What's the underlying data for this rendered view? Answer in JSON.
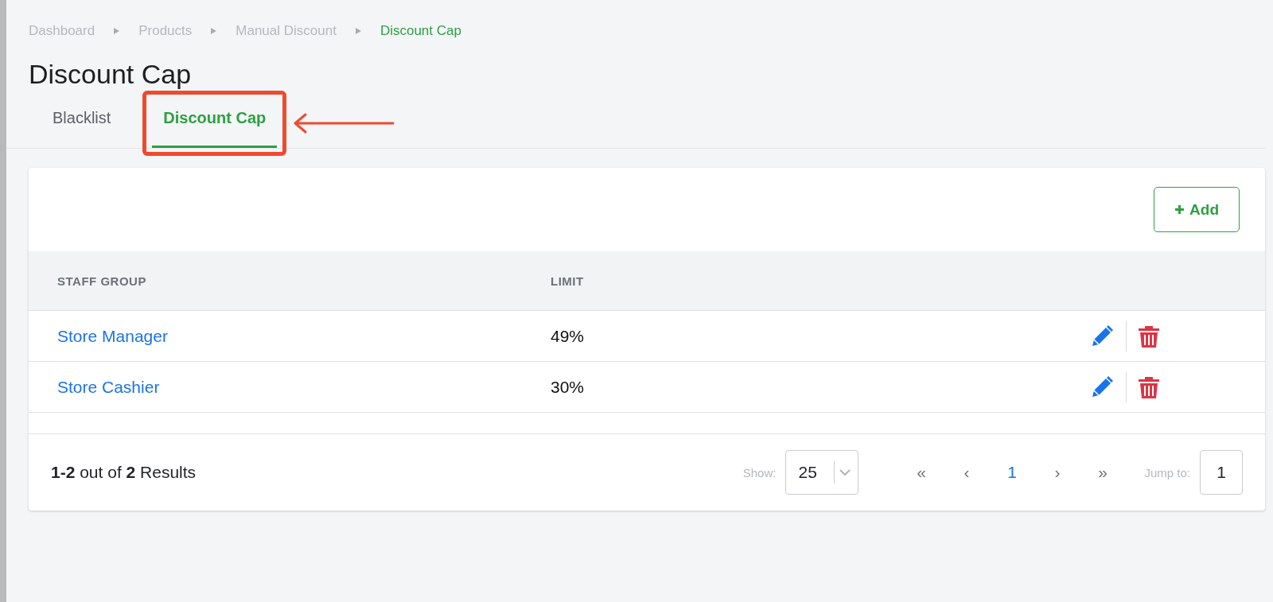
{
  "breadcrumb": [
    {
      "label": "Dashboard",
      "current": false
    },
    {
      "label": "Products",
      "current": false
    },
    {
      "label": "Manual Discount",
      "current": false
    },
    {
      "label": "Discount Cap",
      "current": true
    }
  ],
  "title": "Discount Cap",
  "tabs": [
    {
      "label": "Blacklist",
      "selected": false,
      "highlighted": false
    },
    {
      "label": "Discount Cap",
      "selected": true,
      "highlighted": true
    }
  ],
  "add_button": {
    "label": "Add"
  },
  "table": {
    "columns": [
      "STAFF GROUP",
      "LIMIT"
    ],
    "rows": [
      {
        "staff_group": "Store Manager",
        "limit": "49%"
      },
      {
        "staff_group": "Store Cashier",
        "limit": "30%"
      }
    ]
  },
  "footer": {
    "summary": "**1-2** out of **2** Results",
    "show_label": "Show:",
    "page_size": "25",
    "pagination": [
      {
        "label": "«",
        "selected": false
      },
      {
        "label": "‹",
        "selected": false
      },
      {
        "label": "1",
        "selected": true
      },
      {
        "label": "›",
        "selected": false
      },
      {
        "label": "»",
        "selected": false
      }
    ],
    "jump_label": "Jump to:",
    "jump_value": "1"
  }
}
